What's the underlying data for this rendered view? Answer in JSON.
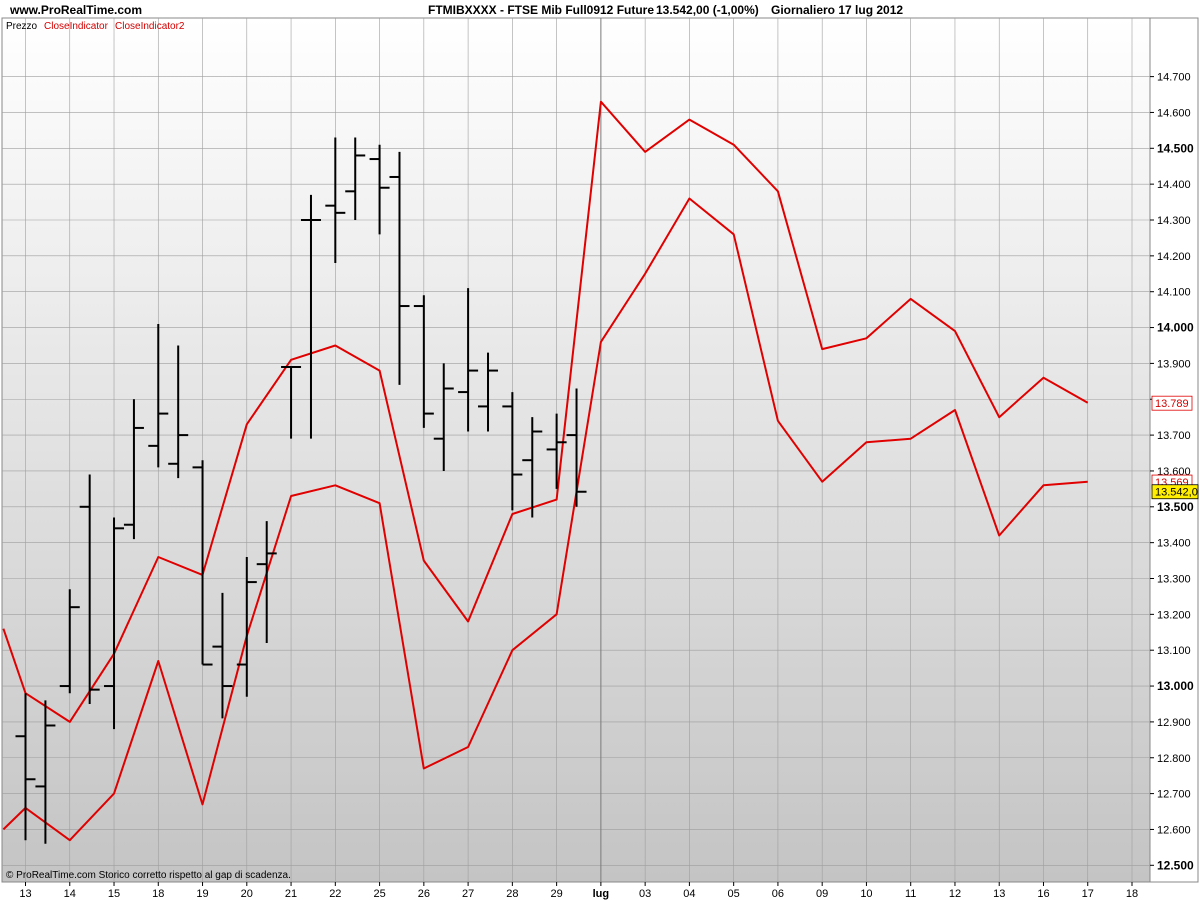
{
  "header": {
    "site": "www.ProRealTime.com",
    "instrument": "FTMIBXXXX - FTSE Mib Full0912 Future",
    "price_change": "13.542,00 (-1,00%)",
    "period_date": "Giornaliero  17 lug 2012"
  },
  "legend": {
    "price": "Prezzo",
    "series1": "CloseIndicator",
    "series2": "CloseIndicator2"
  },
  "footer": {
    "copyright": "© ProRealTime.com  Storico corretto rispetto al gap di scadenza."
  },
  "colors": {
    "indicator": "#e00000",
    "bars": "#000000",
    "last_price_bg": "#ffee00"
  },
  "chart_data": {
    "type": "ohlc",
    "x_labels": [
      "13",
      "14",
      "15",
      "18",
      "19",
      "20",
      "21",
      "22",
      "25",
      "26",
      "27",
      "28",
      "29",
      "lug",
      "03",
      "04",
      "05",
      "06",
      "09",
      "10",
      "11",
      "12",
      "13",
      "16",
      "17",
      "18"
    ],
    "x_label_bold": "lug",
    "y_ticks": [
      "12.500",
      "12.600",
      "12.700",
      "12.800",
      "12.900",
      "13.000",
      "13.100",
      "13.200",
      "13.300",
      "13.400",
      "13.500",
      "13.600",
      "13.700",
      "13.800",
      "13.900",
      "14.000",
      "14.100",
      "14.200",
      "14.300",
      "14.400",
      "14.500",
      "14.600",
      "14.700"
    ],
    "y_major_ticks": [
      "12.500",
      "13.000",
      "13.500",
      "14.000",
      "14.500"
    ],
    "ylim": [
      12500,
      14700
    ],
    "bars": [
      {
        "o": 12860,
        "h": 12980,
        "l": 12570,
        "c": 12740
      },
      {
        "o": 12720,
        "h": 12960,
        "l": 12560,
        "c": 12890
      },
      {
        "o": 13000,
        "h": 13270,
        "l": 12980,
        "c": 13220
      },
      {
        "o": 13500,
        "h": 13590,
        "l": 12950,
        "c": 12990
      },
      {
        "o": 13000,
        "h": 13470,
        "l": 12880,
        "c": 13440
      },
      {
        "o": 13450,
        "h": 13800,
        "l": 13410,
        "c": 13720
      },
      {
        "o": 13670,
        "h": 14010,
        "l": 13610,
        "c": 13760
      },
      {
        "o": 13620,
        "h": 13950,
        "l": 13580,
        "c": 13700
      },
      {
        "o": 13610,
        "h": 13630,
        "l": 13060,
        "c": 13060
      },
      {
        "o": 13110,
        "h": 13260,
        "l": 12910,
        "c": 13000
      },
      {
        "o": 13060,
        "h": 13360,
        "l": 12970,
        "c": 13290
      },
      {
        "o": 13340,
        "h": 13460,
        "l": 13120,
        "c": 13370
      },
      {
        "o": 13890,
        "h": 13890,
        "l": 13690,
        "c": 13890
      },
      {
        "o": 14300,
        "h": 14370,
        "l": 13690,
        "c": 14300
      },
      {
        "o": 14340,
        "h": 14530,
        "l": 14180,
        "c": 14320
      },
      {
        "o": 14380,
        "h": 14530,
        "l": 14300,
        "c": 14480
      },
      {
        "o": 14470,
        "h": 14510,
        "l": 14260,
        "c": 14390
      },
      {
        "o": 14420,
        "h": 14490,
        "l": 13840,
        "c": 14060
      },
      {
        "o": 14060,
        "h": 14090,
        "l": 13720,
        "c": 13760
      },
      {
        "o": 13690,
        "h": 13900,
        "l": 13600,
        "c": 13830
      },
      {
        "o": 13820,
        "h": 14110,
        "l": 13710,
        "c": 13880
      },
      {
        "o": 13780,
        "h": 13930,
        "l": 13710,
        "c": 13880
      },
      {
        "o": 13780,
        "h": 13820,
        "l": 13490,
        "c": 13590
      },
      {
        "o": 13630,
        "h": 13750,
        "l": 13470,
        "c": 13710
      },
      {
        "o": 13660,
        "h": 13760,
        "l": 13550,
        "c": 13680
      },
      {
        "o": 13700,
        "h": 13830,
        "l": 13500,
        "c": 13542
      }
    ],
    "bar_x_positions": [
      0.0,
      0.45,
      1.0,
      1.45,
      2.0,
      2.45,
      3.0,
      3.45,
      4.0,
      4.45,
      5.0,
      5.45,
      6.0,
      6.45,
      7.0,
      7.45,
      8.0,
      8.45,
      9.0,
      9.45,
      10.0,
      10.45,
      11.0,
      11.45,
      12.0,
      12.45
    ],
    "series": [
      {
        "name": "CloseIndicator",
        "points": [
          [
            -0.5,
            13160
          ],
          [
            0,
            12980
          ],
          [
            1,
            12900
          ],
          [
            2,
            13090
          ],
          [
            3,
            13360
          ],
          [
            4,
            13310
          ],
          [
            5,
            13730
          ],
          [
            6,
            13910
          ],
          [
            7,
            13950
          ],
          [
            8,
            13880
          ],
          [
            9,
            13350
          ],
          [
            10,
            13180
          ],
          [
            11,
            13480
          ],
          [
            12,
            13520
          ],
          [
            13,
            14630
          ],
          [
            14,
            14490
          ],
          [
            15,
            14580
          ],
          [
            16,
            14510
          ],
          [
            17,
            14380
          ],
          [
            18,
            13940
          ],
          [
            19,
            13970
          ],
          [
            20,
            14080
          ],
          [
            21,
            13990
          ],
          [
            22,
            13750
          ],
          [
            23,
            13860
          ],
          [
            24,
            13790
          ]
        ]
      },
      {
        "name": "CloseIndicator2",
        "points": [
          [
            -0.5,
            12600
          ],
          [
            0,
            12660
          ],
          [
            1,
            12570
          ],
          [
            2,
            12700
          ],
          [
            3,
            13070
          ],
          [
            4,
            12670
          ],
          [
            5,
            13140
          ],
          [
            6,
            13530
          ],
          [
            7,
            13560
          ],
          [
            8,
            13510
          ],
          [
            9,
            12770
          ],
          [
            10,
            12830
          ],
          [
            11,
            13100
          ],
          [
            12,
            13200
          ],
          [
            13,
            13960
          ],
          [
            14,
            14150
          ],
          [
            15,
            14360
          ],
          [
            16,
            14260
          ],
          [
            17,
            13740
          ],
          [
            18,
            13570
          ],
          [
            19,
            13680
          ],
          [
            20,
            13690
          ],
          [
            21,
            13770
          ],
          [
            22,
            13420
          ],
          [
            23,
            13560
          ],
          [
            24,
            13570
          ]
        ]
      }
    ],
    "price_labels": [
      {
        "text": "13.789",
        "value": 13789,
        "style": "red"
      },
      {
        "text": "13.569",
        "value": 13569,
        "style": "red"
      },
      {
        "text": "13.542,0",
        "value": 13542,
        "style": "yellow"
      }
    ],
    "grid": true
  }
}
